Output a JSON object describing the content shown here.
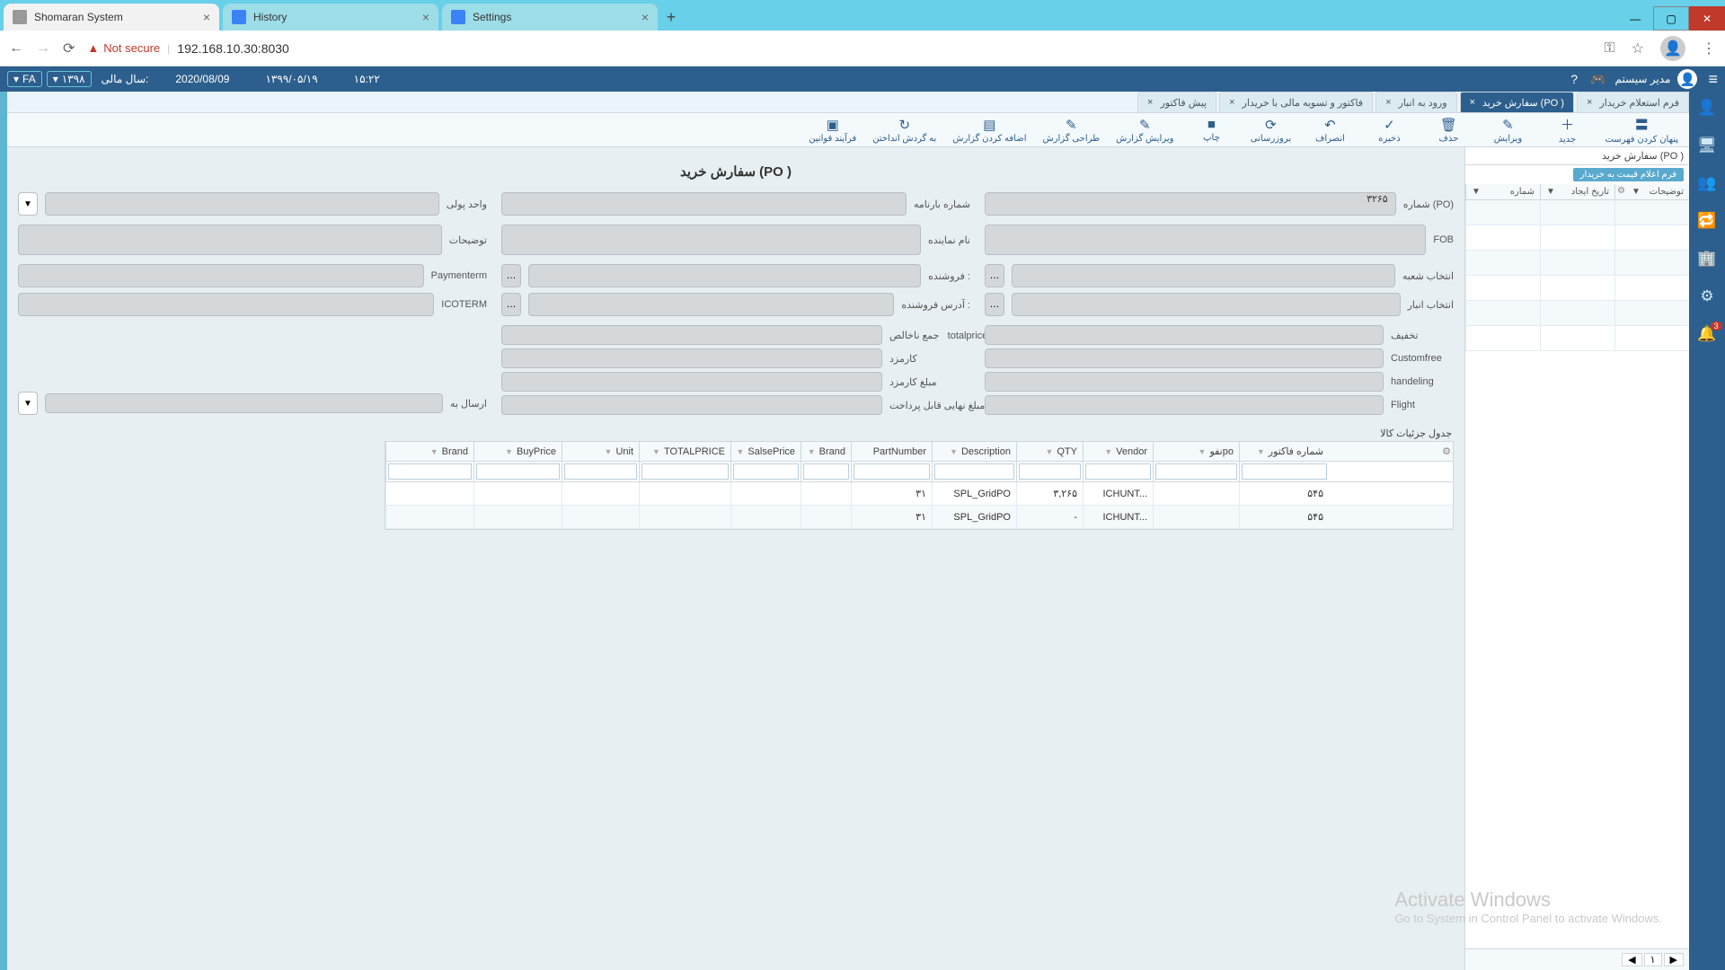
{
  "browser": {
    "tabs": [
      {
        "title": "Shomaran System",
        "active": true
      },
      {
        "title": "History",
        "active": false
      },
      {
        "title": "Settings",
        "active": false
      }
    ],
    "not_secure": "Not secure",
    "url": "192.168.10.30:8030"
  },
  "window_controls": {
    "min": "—",
    "max": "▢",
    "close": "✕"
  },
  "app_header": {
    "lang": "FA",
    "fiscal_year": "۱۳۹۸",
    "fiscal_label": "سال مالی:",
    "date_g": "2020/08/09",
    "date_p": "۱۳۹۹/۰۵/۱۹",
    "time": "۱۵:۲۲",
    "user": "مدیر سیستم"
  },
  "rail_badge": "3",
  "app_tabs": [
    {
      "label": "پیش فاکتور",
      "active": false
    },
    {
      "label": "فاکتور و تسویه مالی با خریدار",
      "active": false
    },
    {
      "label": "ورود به انبار",
      "active": false
    },
    {
      "label": "سفارش خرید (PO )",
      "active": true
    },
    {
      "label": "فرم استعلام خریدار",
      "active": false
    }
  ],
  "toolbar": [
    {
      "icon": "▣",
      "label": "فرآیند قوانین"
    },
    {
      "icon": "↻",
      "label": "به گردش انداختن"
    },
    {
      "icon": "▤",
      "label": "اضافه کردن گزارش"
    },
    {
      "icon": "✎",
      "label": "طراحی گزارش"
    },
    {
      "icon": "✎",
      "label": "ویرایش گزارش"
    },
    {
      "icon": "■",
      "label": "چاپ"
    },
    {
      "icon": "⟳",
      "label": "بروزرسانی"
    },
    {
      "icon": "↶",
      "label": "انصراف"
    },
    {
      "icon": "✓",
      "label": "ذخیره"
    },
    {
      "icon": "🗑",
      "label": "حذف"
    },
    {
      "icon": "✎",
      "label": "ویرایش"
    },
    {
      "icon": "＋",
      "label": "جدید"
    },
    {
      "icon": "〓",
      "label": "پنهان کردن فهرست"
    }
  ],
  "side_panel": {
    "title": "سفارش خرید (PO )",
    "badge": "فرم اعلام قیمت به خریدار",
    "cols": [
      "شماره",
      "تاریخ ایجاد",
      "توضیحات"
    ],
    "page": "۱"
  },
  "form": {
    "title": "سفارش خرید (PO )",
    "po_number_label": "شماره (PO)",
    "po_number_value": "۳۲۶۵",
    "barname_label": "شماره بارنامه",
    "currency_label": "واحد پولی",
    "fob_label": "FOB",
    "agent_label": "نام نماینده",
    "desc_label": "توضیحات",
    "branch_label": "انتخاب شعبه",
    "seller_label": "فروشنده :",
    "payment_label": "Paymenterm",
    "warehouse_label": "انتخاب انبار",
    "seller_addr_label": "آدرس فروشنده :",
    "icoterm_label": "ICOTERM",
    "discount_label": "تخفیف",
    "gross_label": "جمع ناخالص",
    "total_label": "totalprice",
    "customfree_label": "Customfree",
    "fee_label": "کارمزد",
    "sendto_label": "ارسال به",
    "handling_label": "handeling",
    "fee_amount_label": "مبلغ کارمزد",
    "flight_label": "Flight",
    "final_label": "مبلغ نهایی قابل پرداخت"
  },
  "grid": {
    "title": "جدول جزئیات کالا",
    "cols": {
      "brand2": "Brand",
      "buy": "BuyPrice",
      "unit": "Unit",
      "total": "TOTALPRICE",
      "salse": "SalsePrice",
      "brand": "Brand",
      "part": "PartNumber",
      "desc": "Description",
      "qty": "QTY",
      "vendor": "Vendor",
      "nopo": "نفوpo",
      "inv": "شماره فاکتور"
    },
    "rows": [
      {
        "part": "۳۱",
        "desc": "SPL_GridPO",
        "qty": "۳,۲۶۵",
        "vendor": "ICHUNT...",
        "inv": "۵۴۵"
      },
      {
        "part": "۳۱",
        "desc": "SPL_GridPO",
        "qty": "-",
        "vendor": "ICHUNT...",
        "inv": "۵۴۵"
      }
    ]
  },
  "watermark": {
    "line1": "Activate Windows",
    "line2": "Go to System in Control Panel to activate Windows."
  }
}
